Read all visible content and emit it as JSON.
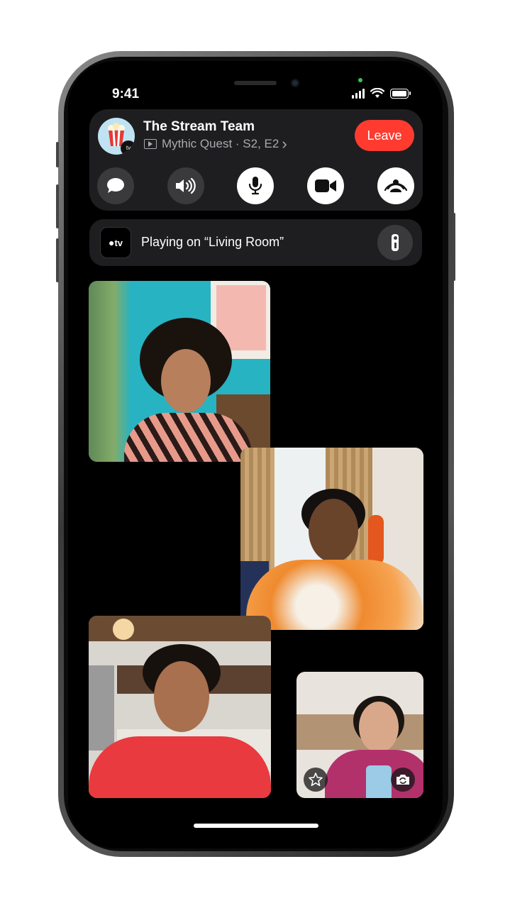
{
  "status": {
    "time": "9:41"
  },
  "session": {
    "title": "The Stream Team",
    "show": "Mythic Quest · S2, E2",
    "chevron": "›",
    "leave_label": "Leave",
    "leave_color": "#ff3b30",
    "avatar_icon": "popcorn-icon",
    "avatar_badge": "tv"
  },
  "controls": [
    {
      "name": "messages",
      "icon": "message-bubble-icon"
    },
    {
      "name": "audio-route",
      "icon": "speaker-icon"
    },
    {
      "name": "microphone",
      "icon": "microphone-icon"
    },
    {
      "name": "camera",
      "icon": "video-camera-icon"
    },
    {
      "name": "shareplay",
      "icon": "shareplay-icon"
    }
  ],
  "playback": {
    "device_icon_label": "tv",
    "text": "Playing on “Living Room”",
    "remote_icon": "remote-icon"
  },
  "self_view": {
    "effects_icon": "effects-star-icon",
    "flip_icon": "camera-flip-icon"
  }
}
